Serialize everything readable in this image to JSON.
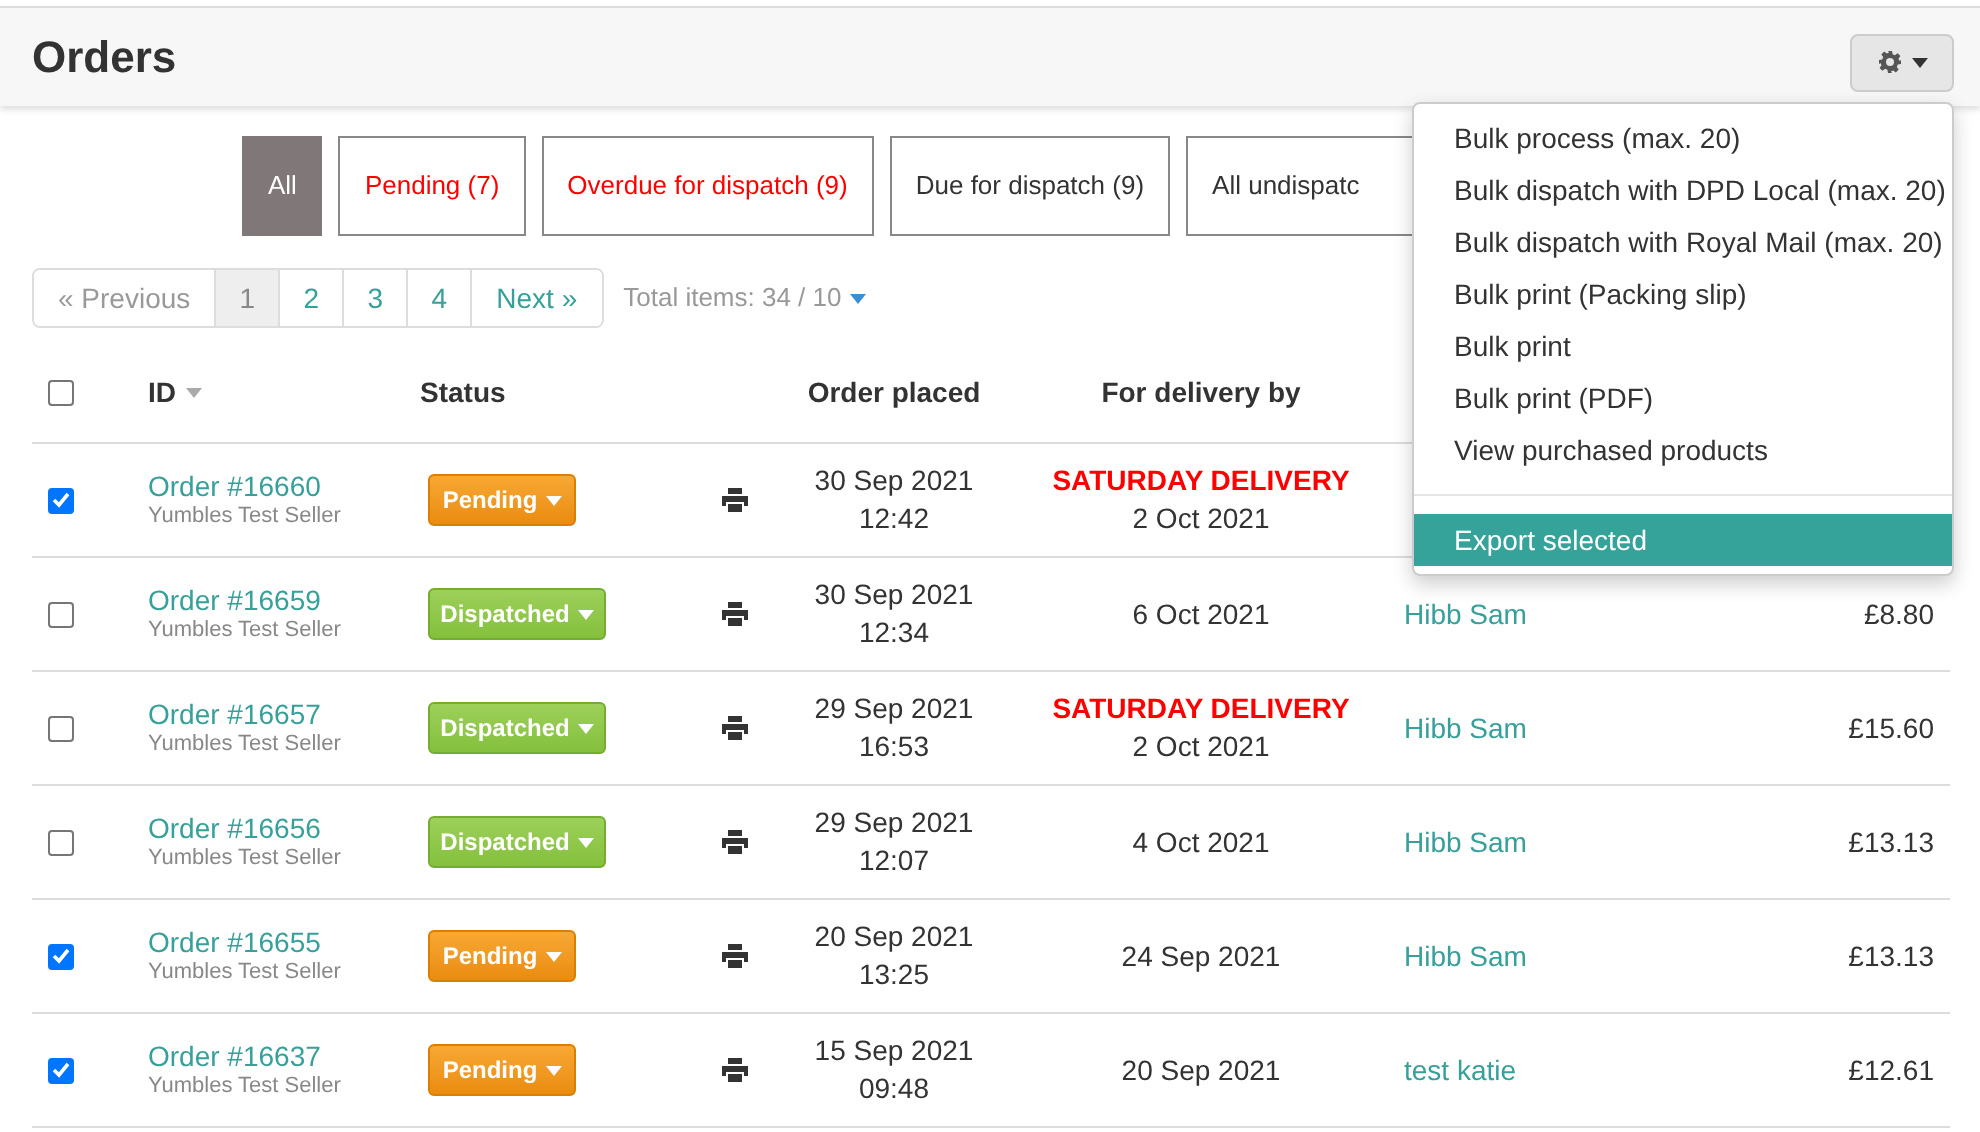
{
  "page": {
    "title": "Orders"
  },
  "filters": [
    {
      "label": "All",
      "selected": true,
      "alert": false
    },
    {
      "label": "Pending (7)",
      "selected": false,
      "alert": true
    },
    {
      "label": "Overdue for dispatch (9)",
      "selected": false,
      "alert": true
    },
    {
      "label": "Due for dispatch (9)",
      "selected": false,
      "alert": false
    },
    {
      "label": "All undispatc",
      "selected": false,
      "alert": false
    }
  ],
  "pagination": [
    {
      "label": "« Previous",
      "selected": false,
      "disabled": true
    },
    {
      "label": "1",
      "selected": true,
      "disabled": false
    },
    {
      "label": "2",
      "selected": false,
      "disabled": false
    },
    {
      "label": "3",
      "selected": false,
      "disabled": false
    },
    {
      "label": "4",
      "selected": false,
      "disabled": false
    },
    {
      "label": "Next »",
      "selected": false,
      "disabled": false
    }
  ],
  "total_items": "Total items: 34 / 10",
  "table": {
    "select_all": {
      "checked": false
    },
    "columns": [
      "ID",
      "Status",
      "Order placed",
      "For delivery by"
    ],
    "rows": [
      {
        "checked": true,
        "order": "Order #16660",
        "seller": "Yumbles Test Seller",
        "status": {
          "label": "Pending",
          "kind": "pending"
        },
        "placed_date": "30 Sep 2021",
        "placed_time": "12:42",
        "delivery_note": "SATURDAY DELIVERY",
        "delivery_date": "2 Oct 2021"
      },
      {
        "checked": false,
        "order": "Order #16659",
        "seller": "Yumbles Test Seller",
        "status": {
          "label": "Dispatched",
          "kind": "dispatched"
        },
        "placed_date": "30 Sep 2021",
        "placed_time": "12:34",
        "delivery_date": "6 Oct 2021",
        "customer": "Hibb Sam",
        "total": "£8.80"
      },
      {
        "checked": false,
        "order": "Order #16657",
        "seller": "Yumbles Test Seller",
        "status": {
          "label": "Dispatched",
          "kind": "dispatched"
        },
        "placed_date": "29 Sep 2021",
        "placed_time": "16:53",
        "delivery_note": "SATURDAY DELIVERY",
        "delivery_date": "2 Oct 2021",
        "customer": "Hibb Sam",
        "total": "£15.60"
      },
      {
        "checked": false,
        "order": "Order #16656",
        "seller": "Yumbles Test Seller",
        "status": {
          "label": "Dispatched",
          "kind": "dispatched"
        },
        "placed_date": "29 Sep 2021",
        "placed_time": "12:07",
        "delivery_date": "4 Oct 2021",
        "customer": "Hibb Sam",
        "total": "£13.13"
      },
      {
        "checked": true,
        "order": "Order #16655",
        "seller": "Yumbles Test Seller",
        "status": {
          "label": "Pending",
          "kind": "pending"
        },
        "placed_date": "20 Sep 2021",
        "placed_time": "13:25",
        "delivery_date": "24 Sep 2021",
        "customer": "Hibb Sam",
        "total": "£13.13"
      },
      {
        "checked": true,
        "order": "Order #16637",
        "seller": "Yumbles Test Seller",
        "status": {
          "label": "Pending",
          "kind": "pending"
        },
        "placed_date": "15 Sep 2021",
        "placed_time": "09:48",
        "delivery_date": "20 Sep 2021",
        "customer": "test katie",
        "total": "£12.61"
      }
    ]
  },
  "menu": {
    "items": [
      {
        "kind": "item",
        "label": "Bulk process (max. 20)",
        "selected": false
      },
      {
        "kind": "item",
        "label": "Bulk dispatch with DPD Local (max. 20)",
        "selected": false
      },
      {
        "kind": "item",
        "label": "Bulk dispatch with Royal Mail (max. 20)",
        "selected": false
      },
      {
        "kind": "item",
        "label": "Bulk print (Packing slip)",
        "selected": false
      },
      {
        "kind": "item",
        "label": "Bulk print",
        "selected": false
      },
      {
        "kind": "item",
        "label": "Bulk print (PDF)",
        "selected": false
      },
      {
        "kind": "item",
        "label": "View purchased products",
        "selected": false
      },
      {
        "kind": "divider"
      },
      {
        "kind": "item",
        "label": "Export selected",
        "selected": true
      }
    ]
  }
}
